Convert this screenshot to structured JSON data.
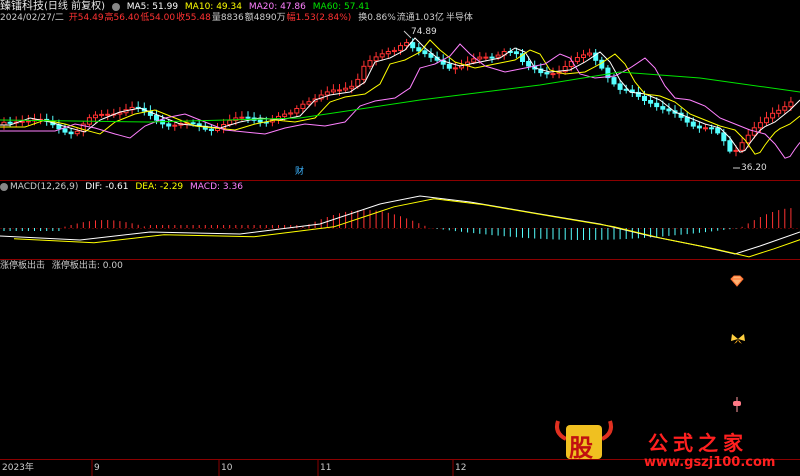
{
  "header": {
    "stock_name": "臻镭科技",
    "period": "(日线 前复权)",
    "ma5": "MA5: 51.99",
    "ma10": "MA10: 49.34",
    "ma20": "MA20: 47.86",
    "ma60": "MA60: 57.41"
  },
  "info": {
    "date": "2024/02/27/二",
    "open": "开54.49",
    "high": "高56.40",
    "low": "低54.00",
    "close": "收55.48",
    "volume": "量8836",
    "amount": "额4890万",
    "change": "幅1.53(2.84%)",
    "turnover": "换0.86%",
    "float_cap": "流通1.03亿",
    "sector": "半导体"
  },
  "annotations": {
    "high_price": "74.89",
    "low_price": "36.20",
    "finance_marker": "财"
  },
  "macd": {
    "params": "MACD(12,26,9)",
    "dif": "DIF: -0.61",
    "dea": "DEA: -2.29",
    "macd": "MACD: 3.36"
  },
  "indicator": {
    "name": "涨停板出击",
    "value_label": "涨停板出击: 0.00"
  },
  "axis": {
    "year_label": "2023年",
    "months": [
      "9",
      "10",
      "11",
      "12"
    ]
  },
  "watermark": {
    "logo_char": "股",
    "site_name": "公式之家",
    "url": "www.gszj100.com"
  },
  "colors": {
    "up": "#ff3232",
    "down": "#54ffff",
    "ma5": "#ffffff",
    "ma10": "#ffff00",
    "ma20": "#ff80ff",
    "ma60": "#00e600",
    "grid": "#800000"
  }
}
